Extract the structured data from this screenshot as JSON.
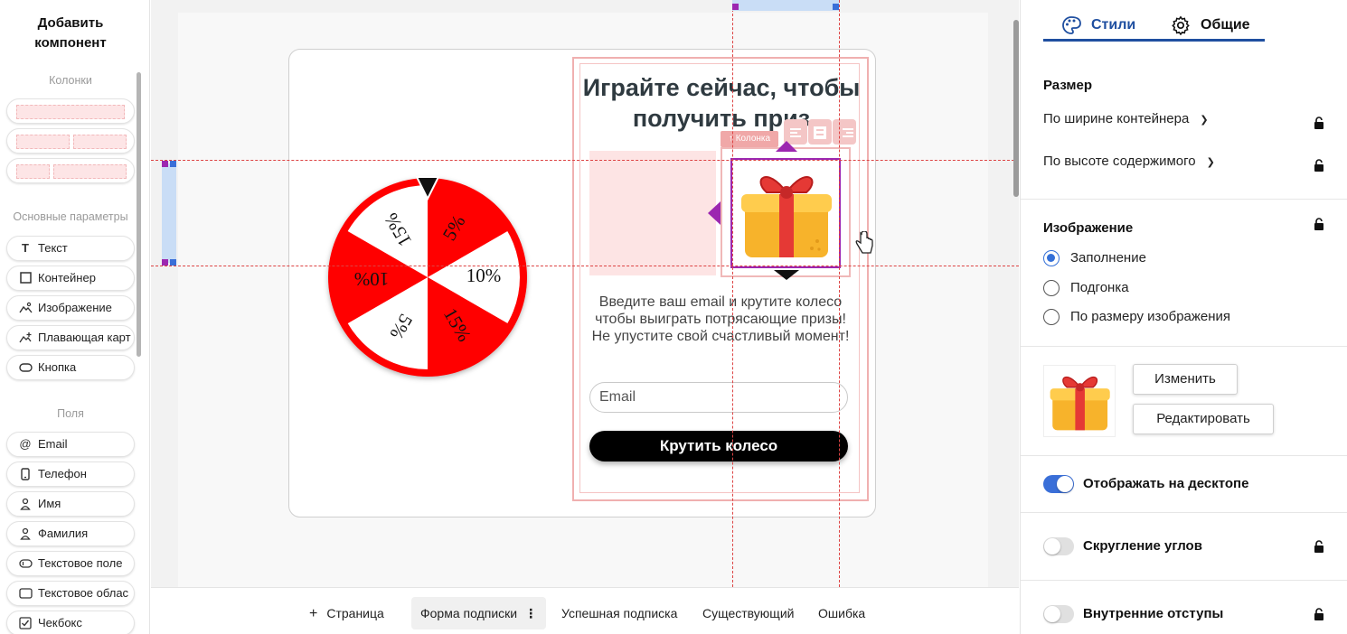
{
  "left_panel": {
    "title": "Добавить компонент",
    "sections": {
      "columns": "Колонки",
      "basic": "Основные параметры",
      "fields": "Поля"
    },
    "basic_items": [
      "Текст",
      "Контейнер",
      "Изображение",
      "Плавающая карт",
      "Кнопка"
    ],
    "field_items": [
      "Email",
      "Телефон",
      "Имя",
      "Фамилия",
      "Текстовое поле",
      "Текстовое облас",
      "Чекбокс"
    ]
  },
  "canvas": {
    "column_tag": "Колонка",
    "headline": "Играйте сейчас, чтобы получить приз",
    "description": "Введите ваш email и крутите колесо чтобы выиграть потрясающие призы! Не упустите свой счастливый момент!",
    "email_placeholder": "Email",
    "spin_button": "Крутить колесо",
    "wheel_labels": [
      "5%",
      "10%",
      "15%",
      "5%",
      "10%",
      "15%"
    ]
  },
  "bottom_tabs": {
    "add_page": "Страница",
    "tabs": [
      "Форма подписки",
      "Успешная подписка",
      "Существующий",
      "Ошибка"
    ]
  },
  "right_panel": {
    "tabs": {
      "styles": "Стили",
      "general": "Общие"
    },
    "size": {
      "title": "Размер",
      "width": "По ширине контейнера",
      "height": "По высоте содержимого"
    },
    "image": {
      "title": "Изображение",
      "options": [
        "Заполнение",
        "Подгонка",
        "По размеру изображения"
      ],
      "selected": 0,
      "change_button": "Изменить",
      "edit_button": "Редактировать"
    },
    "toggles": {
      "desktop": "Отображать на десктопе",
      "rounded": "Скругление углов",
      "padding": "Внутренние отступы"
    }
  },
  "colors": {
    "accent": "#3a6fd8",
    "selection": "#9c27b0",
    "wheel_red": "#ff0000",
    "guide": "#dd4444"
  }
}
